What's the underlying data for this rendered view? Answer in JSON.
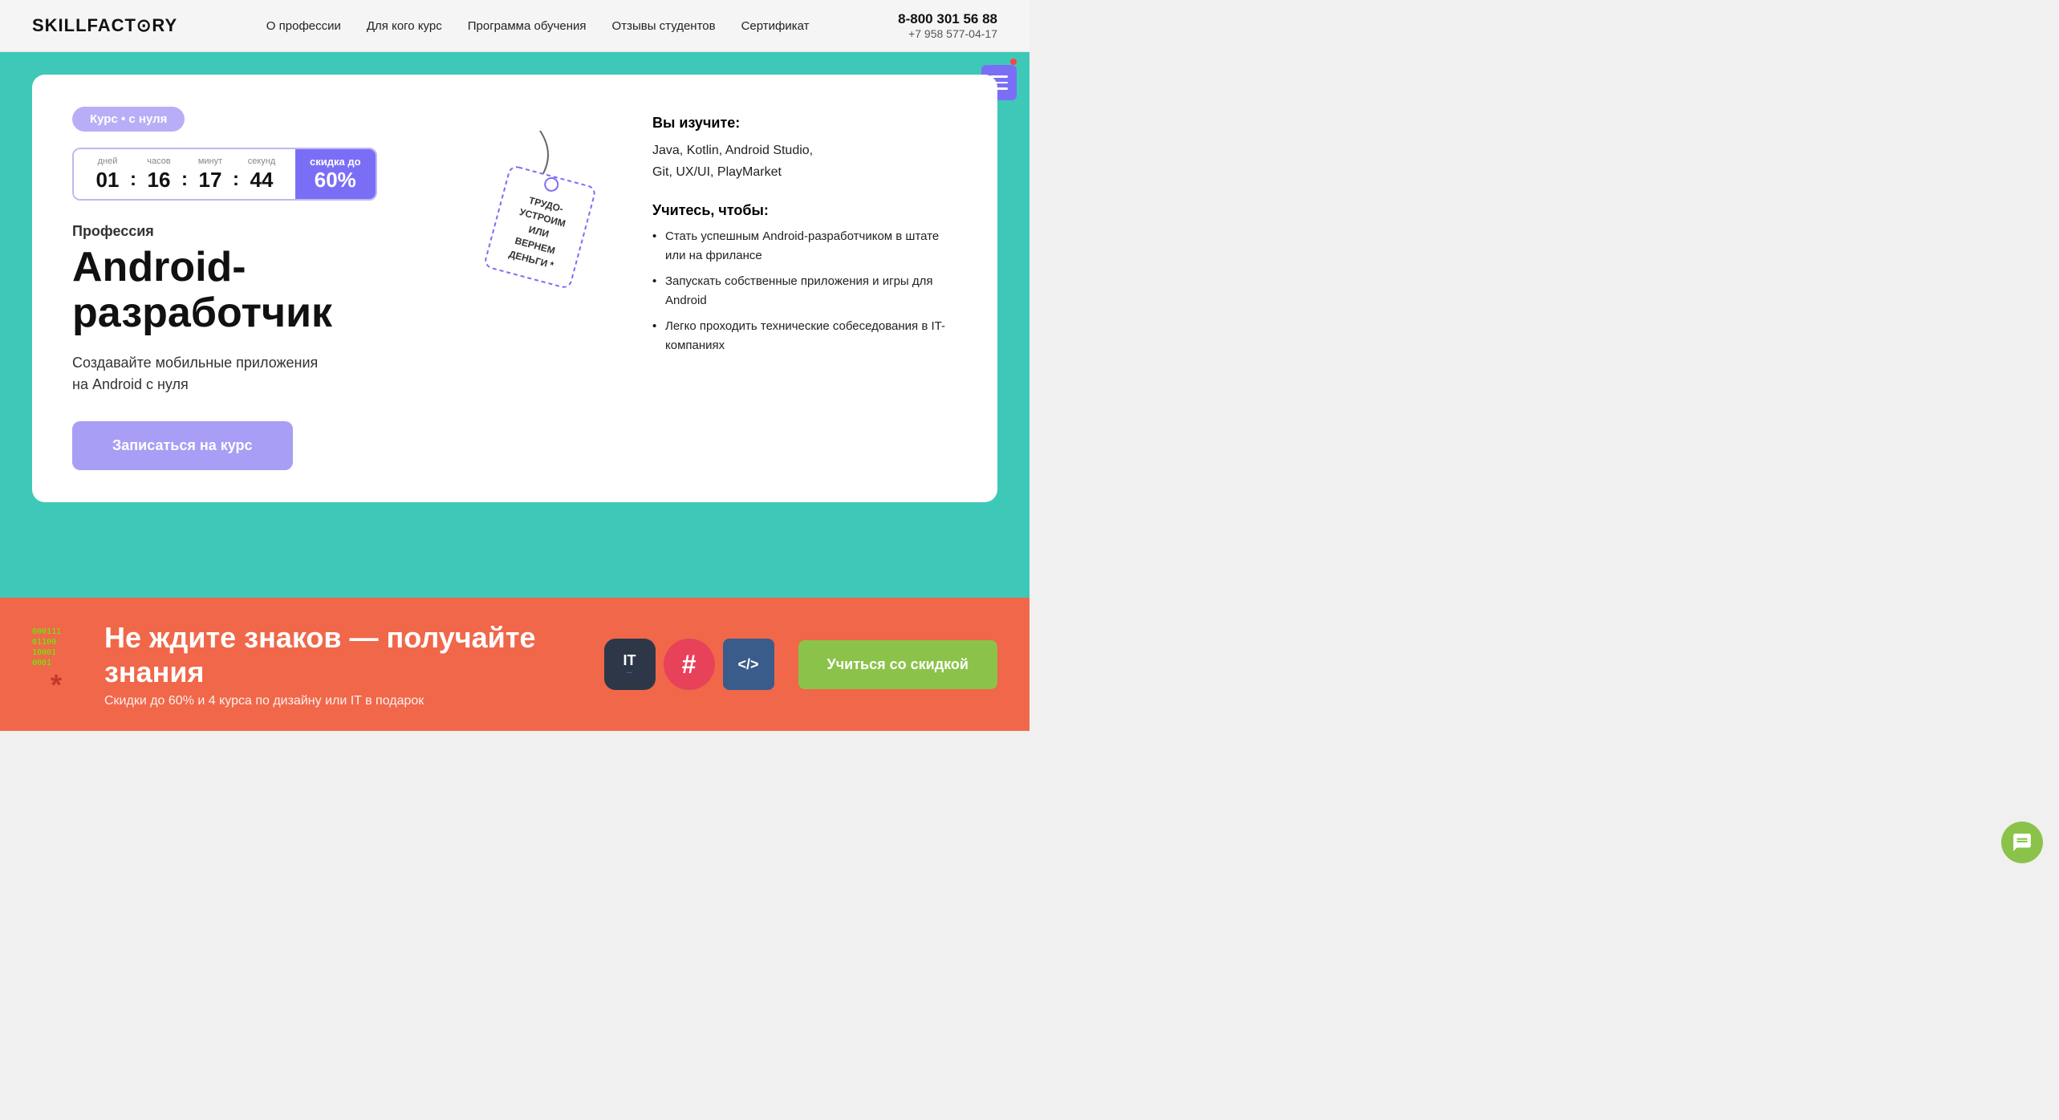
{
  "header": {
    "logo": "SKILLFACT⊙RY",
    "nav": [
      {
        "label": "О профессии",
        "id": "about"
      },
      {
        "label": "Для кого курс",
        "id": "for-whom"
      },
      {
        "label": "Программа обучения",
        "id": "program"
      },
      {
        "label": "Отзывы студентов",
        "id": "reviews"
      },
      {
        "label": "Сертификат",
        "id": "certificate"
      }
    ],
    "phone_main": "8-800 301 56 88",
    "phone_sub": "+7 958 577-04-17"
  },
  "hero": {
    "badge": "Курс • с нуля",
    "countdown": {
      "days_label": "дней",
      "hours_label": "часов",
      "minutes_label": "минут",
      "seconds_label": "секунд",
      "days_value": "01",
      "hours_value": "16",
      "minutes_value": "17",
      "seconds_value": "44",
      "discount_label": "скидка до",
      "discount_value": "60%"
    },
    "profession_label": "Профессия",
    "main_title": "Android-разработчик",
    "subtitle_line1": "Создавайте мобильные приложения",
    "subtitle_line2": "на Android с нуля",
    "cta_button": "Записаться на курс",
    "tag_text": "ТРУДОУСТРОИМ ИЛИ ВЕРНЕМ ДЕНЬГИ *",
    "will_learn_title": "Вы изучите:",
    "will_learn_text": "Java, Kotlin, Android Studio,\nGit, UX/UI, PlayMarket",
    "goals_title": "Учитесь, чтобы:",
    "goals": [
      "Стать успешным Android-разработчиком в штате или на фрилансе",
      "Запускать собственные приложения и игры для Android",
      "Легко проходить технические собеседования в IT-компаниях"
    ]
  },
  "banner": {
    "binary_text": "000111\n01100\n10001\n0001",
    "asterisk": "*",
    "main_text": "Не ждите знаков — получайте знания",
    "sub_text": "Скидки до 60% и 4 курса по дизайну или IT в подарок",
    "it_label": "IT",
    "it_dot": "...",
    "hash_symbol": "#",
    "code_symbol": "</>",
    "cta_button": "Учиться со скидкой"
  },
  "chat_button": {
    "icon": "chat-icon"
  }
}
